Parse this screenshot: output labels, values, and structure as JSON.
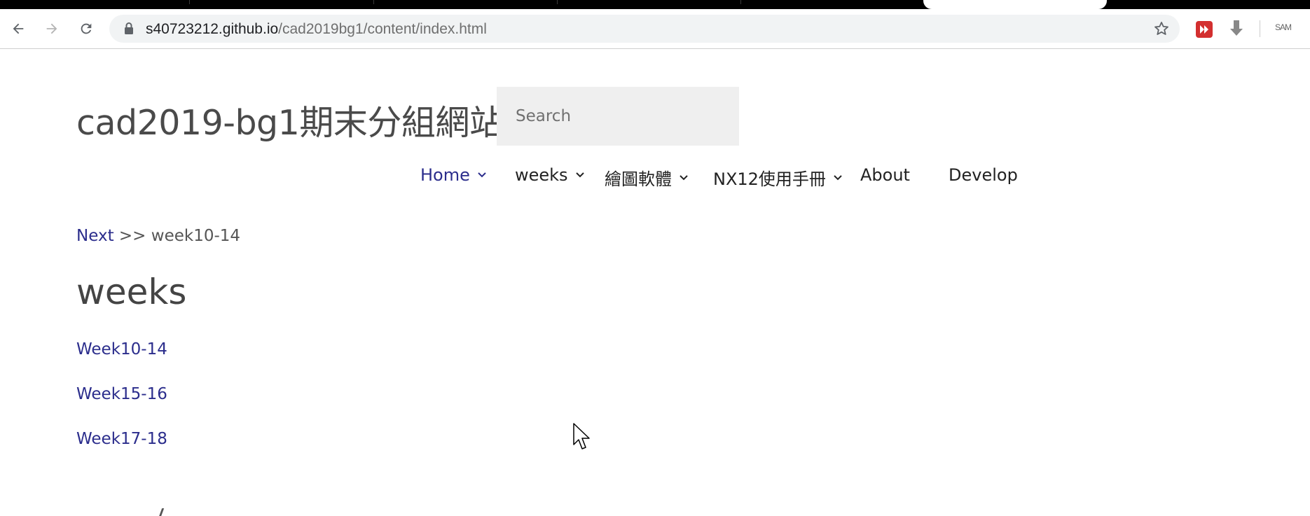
{
  "browser": {
    "url_host": "s40723212.github.io",
    "url_path": "/cad2019bg1/content/index.html",
    "profile_label": "SAM",
    "icons": {
      "back": "back-arrow-icon",
      "forward": "forward-arrow-icon",
      "reload": "reload-icon",
      "lock": "lock-icon",
      "star": "star-icon",
      "extension": "red-extension-icon",
      "download": "download-icon"
    }
  },
  "site": {
    "title": "cad2019-bg1期末分組網站",
    "search_placeholder": "Search"
  },
  "nav": {
    "items": [
      {
        "label": "Home",
        "has_dropdown": true,
        "active": true
      },
      {
        "label": "weeks",
        "has_dropdown": true,
        "active": false
      },
      {
        "label": "繪圖軟體",
        "has_dropdown": true,
        "active": false
      },
      {
        "label": "NX12使用手冊",
        "has_dropdown": true,
        "active": false
      },
      {
        "label": "About",
        "has_dropdown": false,
        "active": false
      },
      {
        "label": "Develop",
        "has_dropdown": false,
        "active": false
      }
    ]
  },
  "breadcrumb": {
    "next_label": "Next",
    "separator": ">>",
    "target": "week10-14"
  },
  "content": {
    "heading": "weeks",
    "links": [
      "Week10-14",
      "Week15-16",
      "Week17-18"
    ]
  },
  "colors": {
    "link": "#2b2d8c",
    "text": "#444444",
    "search_bg": "#efefef"
  }
}
